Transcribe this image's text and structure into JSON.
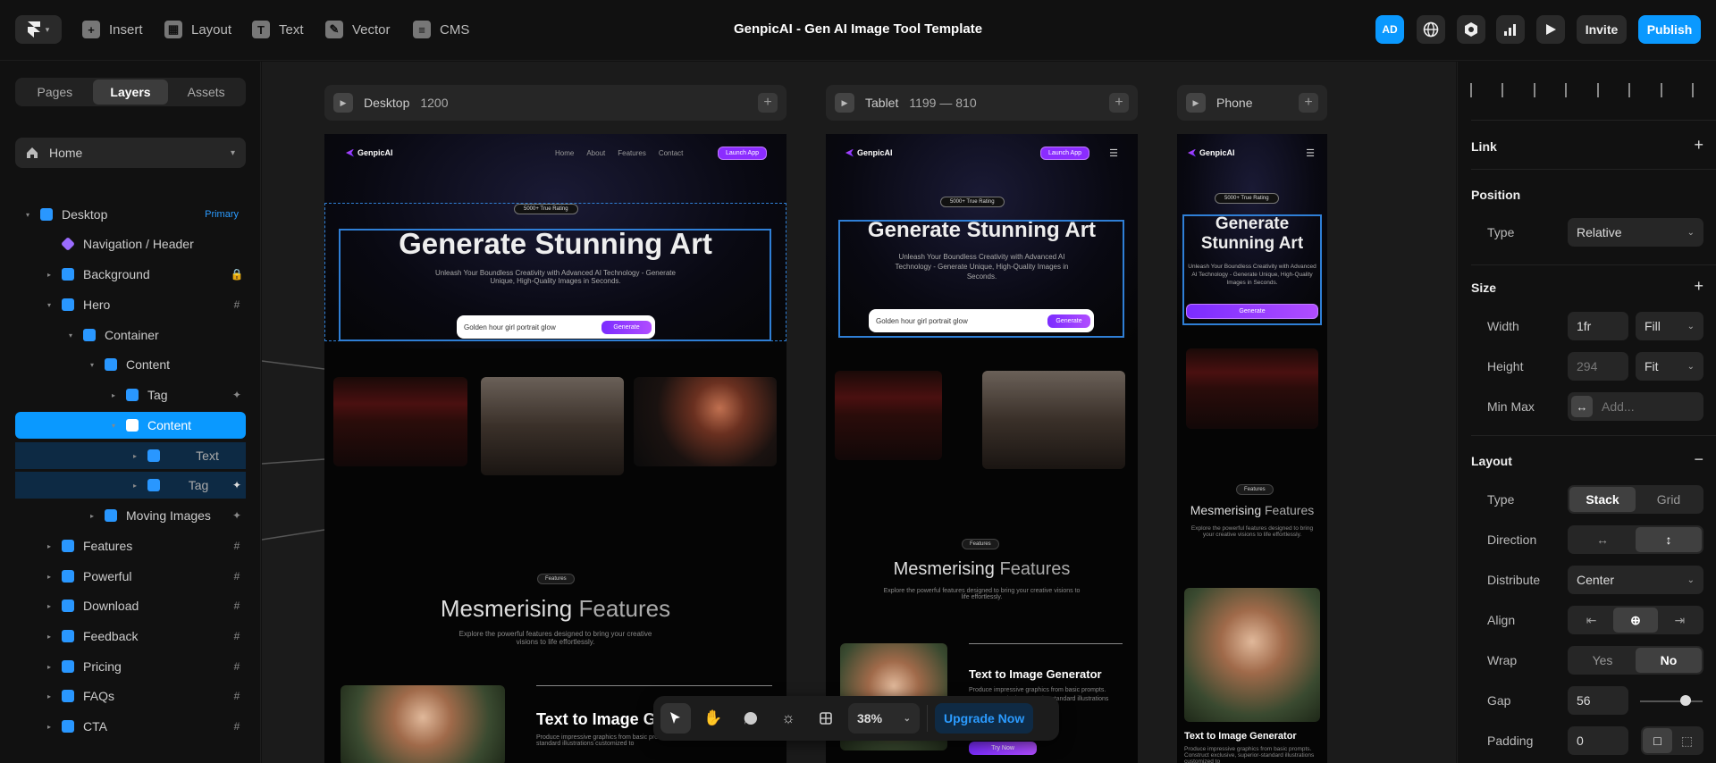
{
  "app": {
    "title": "GenpicAI - Gen AI Image Tool Template",
    "user_initials": "AD",
    "invite": "Invite",
    "publish": "Publish",
    "toolbar": [
      {
        "label": "Insert",
        "icon": "plus-icon"
      },
      {
        "label": "Layout",
        "icon": "layout-icon"
      },
      {
        "label": "Text",
        "icon": "text-icon"
      },
      {
        "label": "Vector",
        "icon": "pen-icon"
      },
      {
        "label": "CMS",
        "icon": "database-icon"
      }
    ]
  },
  "sidebar": {
    "tabs": [
      "Pages",
      "Layers",
      "Assets"
    ],
    "active_tab": "Layers",
    "page": "Home",
    "layers": [
      {
        "label": "Desktop",
        "badge": "Primary",
        "depth": 0,
        "caret": "▾"
      },
      {
        "label": "Navigation / Header",
        "depth": 1,
        "caret": "",
        "icon": "component"
      },
      {
        "label": "Background",
        "depth": 1,
        "caret": "▸",
        "tail": "🔒"
      },
      {
        "label": "Hero",
        "depth": 1,
        "caret": "▾",
        "tail": "#"
      },
      {
        "label": "Container",
        "depth": 2,
        "caret": "▾"
      },
      {
        "label": "Content",
        "depth": 3,
        "caret": "▾"
      },
      {
        "label": "Tag",
        "depth": 4,
        "caret": "▸",
        "tail": "✦"
      },
      {
        "label": "Content",
        "depth": 4,
        "caret": "▾",
        "state": "selected"
      },
      {
        "label": "Text",
        "depth": 5,
        "caret": "▸",
        "state": "child"
      },
      {
        "label": "Tag",
        "depth": 5,
        "caret": "▸",
        "tail": "✦",
        "state": "child"
      },
      {
        "label": "Moving Images",
        "depth": 3,
        "caret": "▸",
        "tail": "✦"
      },
      {
        "label": "Features",
        "depth": 1,
        "caret": "▸",
        "tail": "#"
      },
      {
        "label": "Powerful",
        "depth": 1,
        "caret": "▸",
        "tail": "#"
      },
      {
        "label": "Download",
        "depth": 1,
        "caret": "▸",
        "tail": "#"
      },
      {
        "label": "Feedback",
        "depth": 1,
        "caret": "▸",
        "tail": "#"
      },
      {
        "label": "Pricing",
        "depth": 1,
        "caret": "▸",
        "tail": "#"
      },
      {
        "label": "FAQs",
        "depth": 1,
        "caret": "▸",
        "tail": "#"
      },
      {
        "label": "CTA",
        "depth": 1,
        "caret": "▸",
        "tail": "#"
      }
    ]
  },
  "canvas": {
    "frames": [
      {
        "name": "Desktop",
        "dims": "1200"
      },
      {
        "name": "Tablet",
        "dims": "1199 — 810"
      },
      {
        "name": "Phone",
        "dims": ""
      }
    ],
    "site": {
      "brand": "GenpicAI",
      "nav": [
        "Home",
        "About",
        "Features",
        "Contact"
      ],
      "launch": "Launch App",
      "rating": "5000+ True Rating",
      "headline": "Generate Stunning Art",
      "subhead": "Unleash Your Boundless Creativity with Advanced AI Technology - Generate Unique, High-Quality Images in Seconds.",
      "prompt": "Golden hour girl portrait glow",
      "generate": "Generate",
      "features_tag": "Features",
      "features_title_a": "Mesmerising",
      "features_title_b": "Features",
      "features_sub": "Explore the powerful features designed to bring your creative visions to life effortlessly.",
      "tti": "Text to Image Generator",
      "tti_short": "Text to Image G",
      "tti_desc": "Produce impressive graphics from basic prompts. Construct exclusive, superior-standard illustrations customized to",
      "tti_desc_tab": "Produce impressive graphics from basic prompts. Construct exclusive, superior-standard illustrations customized to your thoughts.",
      "try_now": "Try Now"
    },
    "zoom": "38%",
    "upgrade": "Upgrade Now"
  },
  "panel": {
    "link": "Link",
    "position": "Position",
    "type_label": "Type",
    "position_type": "Relative",
    "size": "Size",
    "width_label": "Width",
    "width_val": "1fr",
    "width_mode": "Fill",
    "height_label": "Height",
    "height_val": "294",
    "height_mode": "Fit",
    "minmax_label": "Min Max",
    "minmax_placeholder": "Add...",
    "layout": "Layout",
    "layout_type_label": "Type",
    "layout_types": [
      "Stack",
      "Grid"
    ],
    "layout_type_active": "Stack",
    "direction_label": "Direction",
    "distribute_label": "Distribute",
    "distribute": "Center",
    "align_label": "Align",
    "wrap_label": "Wrap",
    "wrap_opts": [
      "Yes",
      "No"
    ],
    "wrap_active": "No",
    "gap_label": "Gap",
    "gap": "56",
    "gap_slider": 0.5,
    "padding_label": "Padding",
    "padding": "0",
    "accent": "#0a99ff"
  }
}
